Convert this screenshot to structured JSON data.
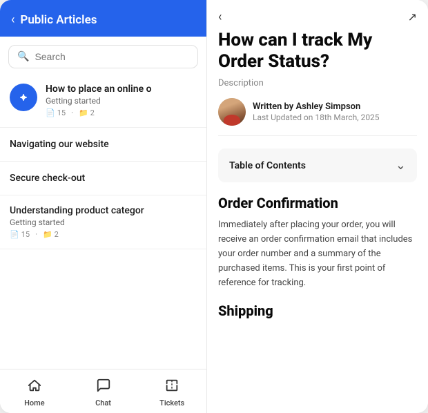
{
  "left_panel": {
    "header": {
      "back_label": "‹",
      "title": "Public Articles"
    },
    "search": {
      "placeholder": "Search"
    },
    "articles": [
      {
        "id": "featured",
        "title": "How to place an online o",
        "subtitle": "Getting started",
        "meta_articles": "15",
        "meta_folders": "2",
        "has_icon": true
      },
      {
        "id": "simple1",
        "title": "Navigating our website"
      },
      {
        "id": "simple2",
        "title": "Secure check-out"
      },
      {
        "id": "bottom1",
        "title": "Understanding product categor",
        "subtitle": "Getting started",
        "meta_articles": "15",
        "meta_folders": "2"
      }
    ]
  },
  "bottom_nav": {
    "items": [
      {
        "id": "home",
        "label": "Home",
        "icon": "⌂"
      },
      {
        "id": "chat",
        "label": "Chat",
        "icon": "⊡"
      },
      {
        "id": "tickets",
        "label": "Tickets",
        "icon": "◇"
      }
    ]
  },
  "right_panel": {
    "top_bar": {
      "back": "‹",
      "expand": "↗"
    },
    "article": {
      "title": "How can I track My Order Status?",
      "description_label": "Description",
      "author": {
        "written_by": "Written by Ashley Simpson",
        "last_updated": "Last Updated on 18th March, 2025"
      },
      "toc": {
        "label": "Table of Contents",
        "chevron": "⌄"
      },
      "sections": [
        {
          "id": "order-confirmation",
          "title": "Order Confirmation",
          "text": "Immediately after placing your order, you will receive an order confirmation email that includes your order number and a summary of the purchased items. This is your first point of reference for tracking."
        },
        {
          "id": "shipping",
          "title": "Shipping"
        }
      ]
    }
  }
}
